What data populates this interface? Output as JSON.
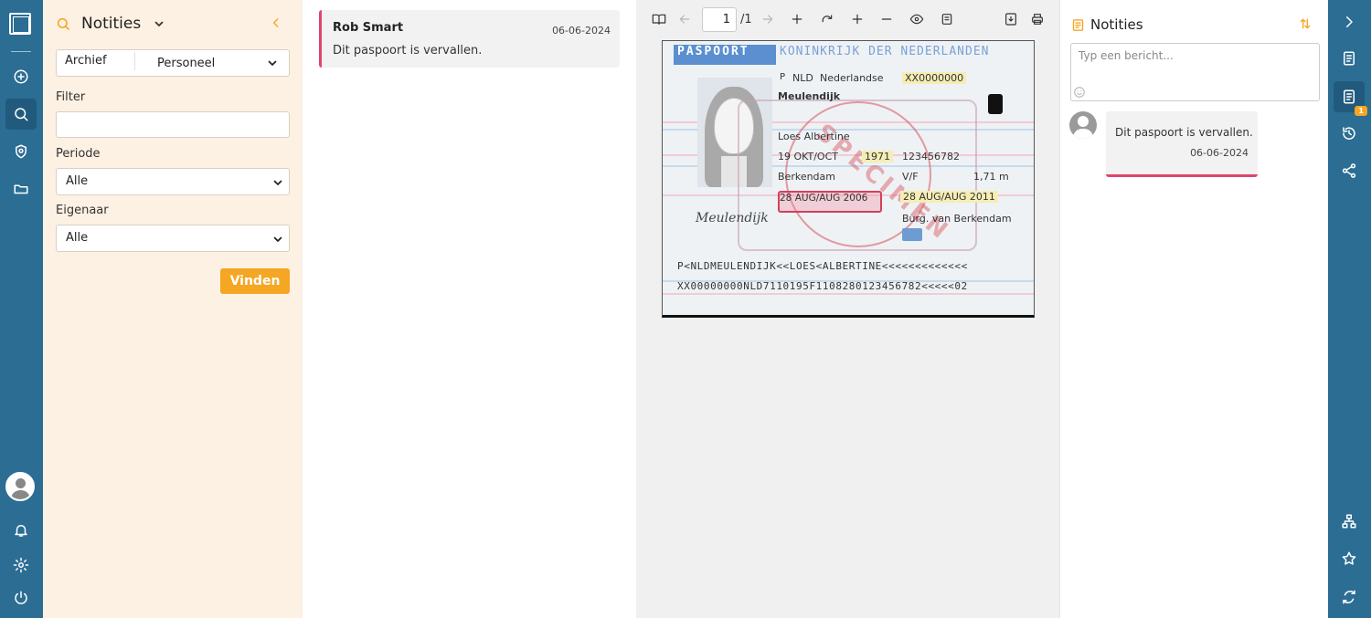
{
  "filter_panel": {
    "title": "Notities",
    "segment": {
      "left": "Archief",
      "right": "Personeel"
    },
    "filter_label": "Filter",
    "filter_value": "",
    "period_label": "Periode",
    "period_value": "Alle",
    "owner_label": "Eigenaar",
    "owner_value": "Alle",
    "find_label": "Vinden"
  },
  "notes_list": [
    {
      "author": "Rob Smart",
      "date": "06-06-2024",
      "text": "Dit paspoort is vervallen."
    }
  ],
  "viewer": {
    "page_current": "1",
    "page_total": "/1"
  },
  "document": {
    "header": "PASPOORT",
    "kingdom": "KONINKRIJK DER NEDERLANDEN",
    "type": "P",
    "code": "NLD",
    "nationality": "Nederlandse",
    "doc_number": "XX0000000",
    "surname": "Meulendijk",
    "given_names": "Loes Albertine",
    "birth_date": "19 OKT/OCT",
    "birth_year": "1971",
    "personal_number": "123456782",
    "birth_place": "Berkendam",
    "sex": "V/F",
    "height": "1,71 m",
    "issue_date": "28 AUG/AUG 2006",
    "expiry_date": "28 AUG/AUG 2011",
    "authority": "Burg. van Berkendam",
    "specimen": "SPECIMEN",
    "mrz_line1": "P<NLDMEULENDIJK<<LOES<ALBERTINE<<<<<<<<<<<<<",
    "mrz_line2": "XX00000000NLD7110195F1108280123456782<<<<<02"
  },
  "side_notes": {
    "title": "Notities",
    "placeholder": "Typ een bericht...",
    "messages": [
      {
        "text": "Dit paspoort is vervallen.",
        "date": "06-06-2024"
      }
    ]
  },
  "right_rail": {
    "notes_badge": "1"
  },
  "colors": {
    "rail": "#2b6d93",
    "accent": "#f5a623",
    "note_marker": "#e0446b",
    "filter_bg": "#fdf1e3"
  }
}
